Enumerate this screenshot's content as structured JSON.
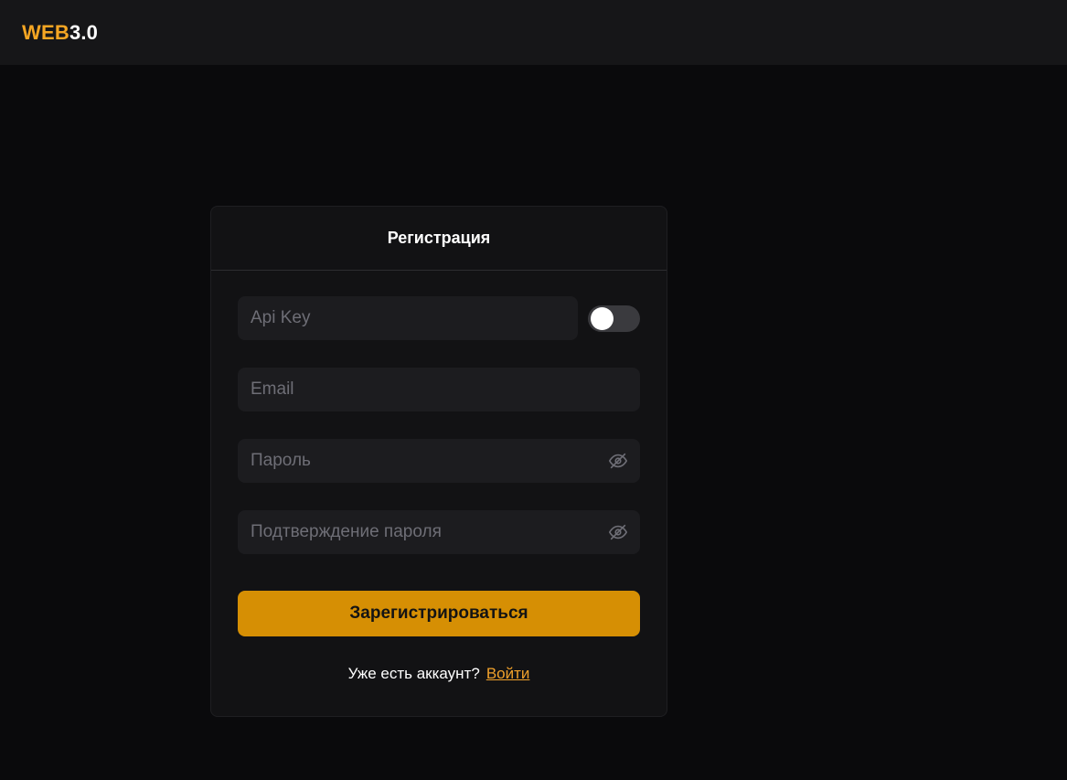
{
  "header": {
    "logo_accent": "WEB",
    "logo_rest": "3.0"
  },
  "form": {
    "title": "Регистрация",
    "api_key": {
      "placeholder": "Api Key",
      "value": ""
    },
    "api_toggle": {
      "on": false
    },
    "email": {
      "placeholder": "Email",
      "value": ""
    },
    "password": {
      "placeholder": "Пароль",
      "value": ""
    },
    "confirm_password": {
      "placeholder": "Подтверждение пароля",
      "value": ""
    },
    "submit_label": "Зарегистрироваться",
    "footer_text": "Уже есть аккаунт?",
    "login_link": "Войти"
  },
  "colors": {
    "accent": "#f5a623",
    "button": "#d68f04",
    "link": "#f0a12b"
  },
  "icons": {
    "password_visibility": "eye-off-icon"
  }
}
